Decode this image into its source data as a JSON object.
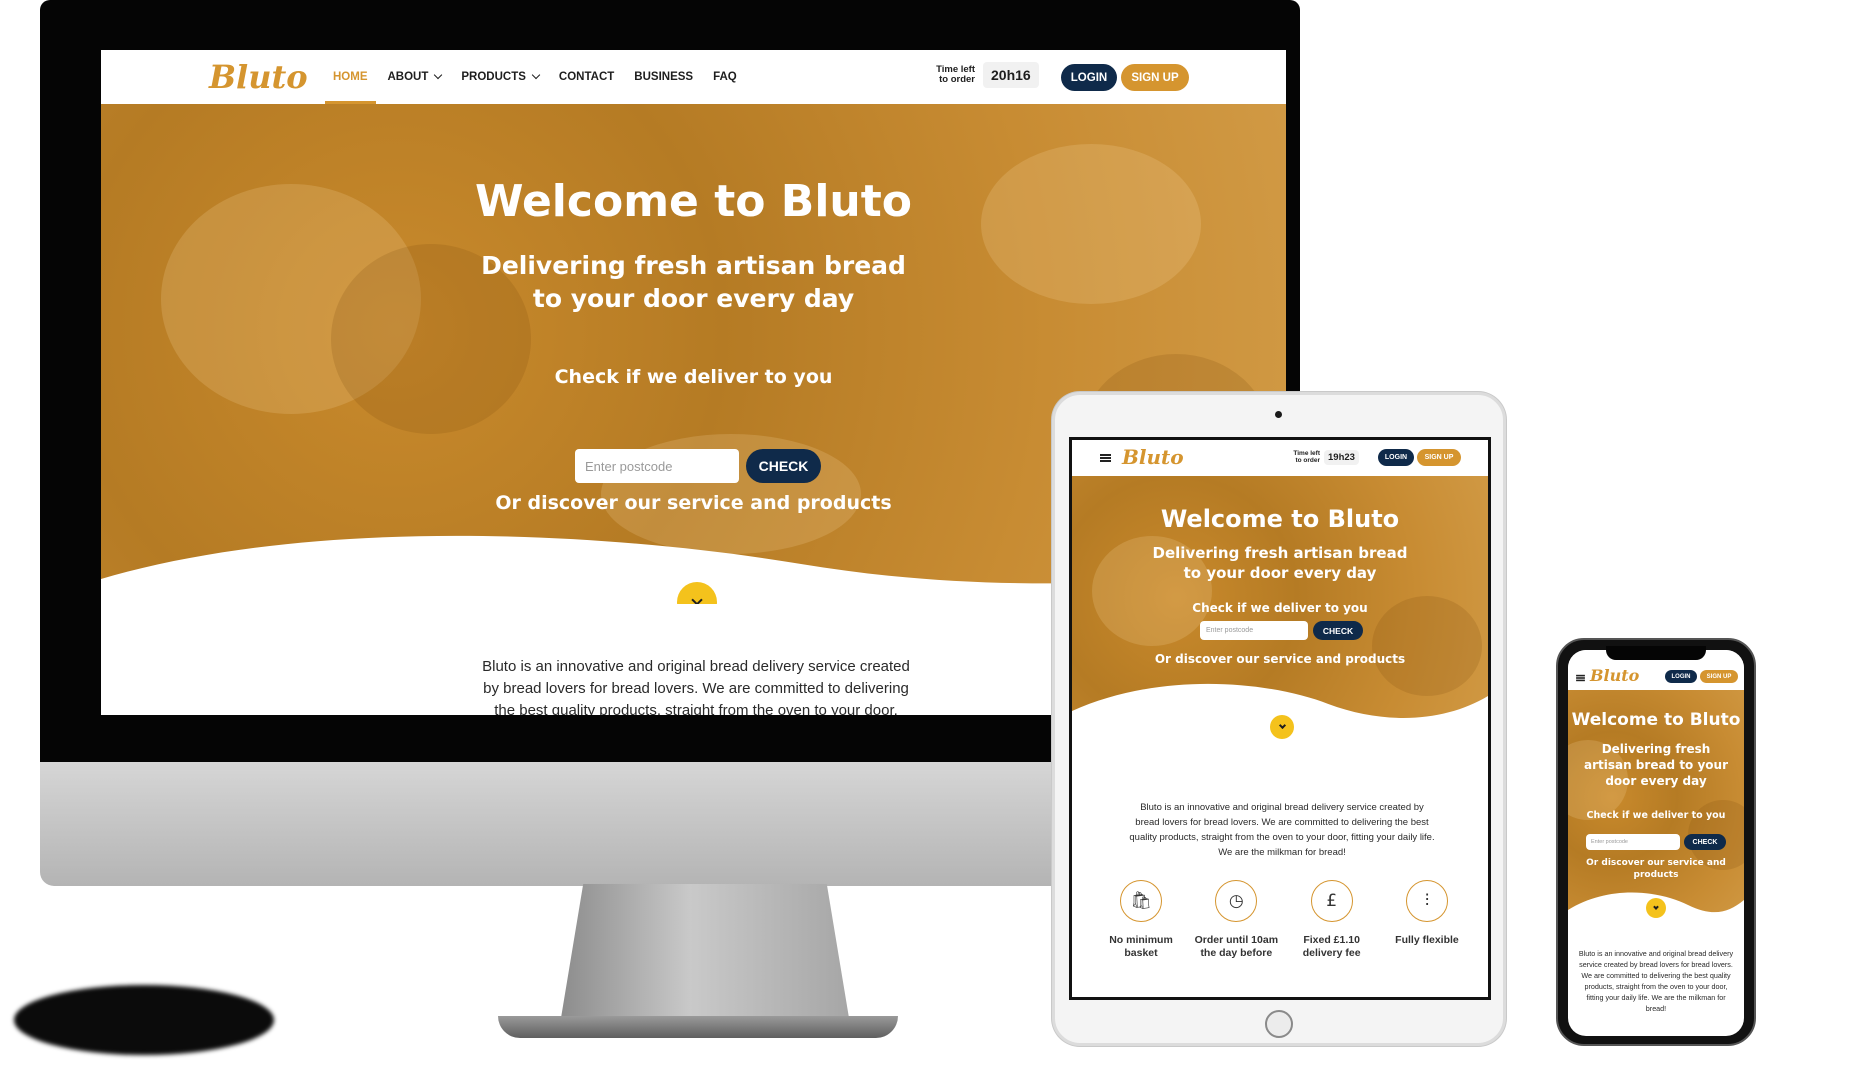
{
  "brand": {
    "logo_text": "Bluto",
    "accent_color": "#d5952f",
    "navy_color": "#0f2a4a",
    "yellow_color": "#f4c21c"
  },
  "desktop": {
    "nav": {
      "items": [
        {
          "label": "HOME",
          "dropdown": false,
          "active": true
        },
        {
          "label": "ABOUT",
          "dropdown": true,
          "active": false
        },
        {
          "label": "PRODUCTS",
          "dropdown": true,
          "active": false
        },
        {
          "label": "CONTACT",
          "dropdown": false,
          "active": false
        },
        {
          "label": "BUSINESS",
          "dropdown": false,
          "active": false
        },
        {
          "label": "FAQ",
          "dropdown": false,
          "active": false
        }
      ],
      "time_left_label": "Time left to order",
      "time_left_value": "20h16",
      "login_label": "LOGIN",
      "signup_label": "SIGN UP"
    },
    "hero": {
      "title": "Welcome to Bluto",
      "subtitle_line1": "Delivering fresh artisan bread",
      "subtitle_line2": "to your door every day",
      "check_label": "Check if we deliver to you",
      "postcode_placeholder": "Enter postcode",
      "check_button": "CHECK",
      "discover_label": "Or discover our service and products"
    },
    "about": {
      "line1": "Bluto is an innovative and original bread delivery service created",
      "line2": "by bread lovers for bread lovers. We are committed to delivering",
      "line3": "the best quality products, straight from the oven to your door,"
    }
  },
  "tablet": {
    "nav": {
      "time_left_label": "Time left to order",
      "time_left_value": "19h23",
      "login_label": "LOGIN",
      "signup_label": "SIGN UP"
    },
    "hero": {
      "title": "Welcome to Bluto",
      "subtitle_line1": "Delivering fresh artisan bread",
      "subtitle_line2": "to your door every day",
      "check_label": "Check if we deliver to you",
      "postcode_placeholder": "Enter postcode",
      "check_button": "CHECK",
      "discover_label": "Or discover our service and products"
    },
    "about": "Bluto is an innovative and original bread delivery service created by bread lovers for bread lovers. We are committed to delivering the best quality products, straight from the oven to your door, fitting your daily life. We are the milkman for bread!",
    "features": [
      {
        "icon": "basket-icon",
        "glyph": "🛍",
        "label": "No minimum basket"
      },
      {
        "icon": "clock-icon",
        "glyph": "◷",
        "label": "Order until 10am the day before"
      },
      {
        "icon": "pound-icon",
        "glyph": "£",
        "label": "Fixed £1.10 delivery fee"
      },
      {
        "icon": "sliders-icon",
        "glyph": "⫶",
        "label": "Fully flexible"
      }
    ]
  },
  "mobile": {
    "nav": {
      "login_label": "LOGIN",
      "signup_label": "SIGN UP"
    },
    "hero": {
      "title": "Welcome to Bluto",
      "subtitle": "Delivering fresh artisan bread to your door every day",
      "check_label": "Check if we deliver to you",
      "postcode_placeholder": "Enter postcode",
      "check_button": "CHECK",
      "discover_label": "Or discover our service and products"
    },
    "about": "Bluto is an innovative and original bread delivery service created by bread lovers for bread lovers. We are committed to delivering the best quality products, straight from the oven to your door, fitting your daily life. We are the milkman for bread!"
  }
}
